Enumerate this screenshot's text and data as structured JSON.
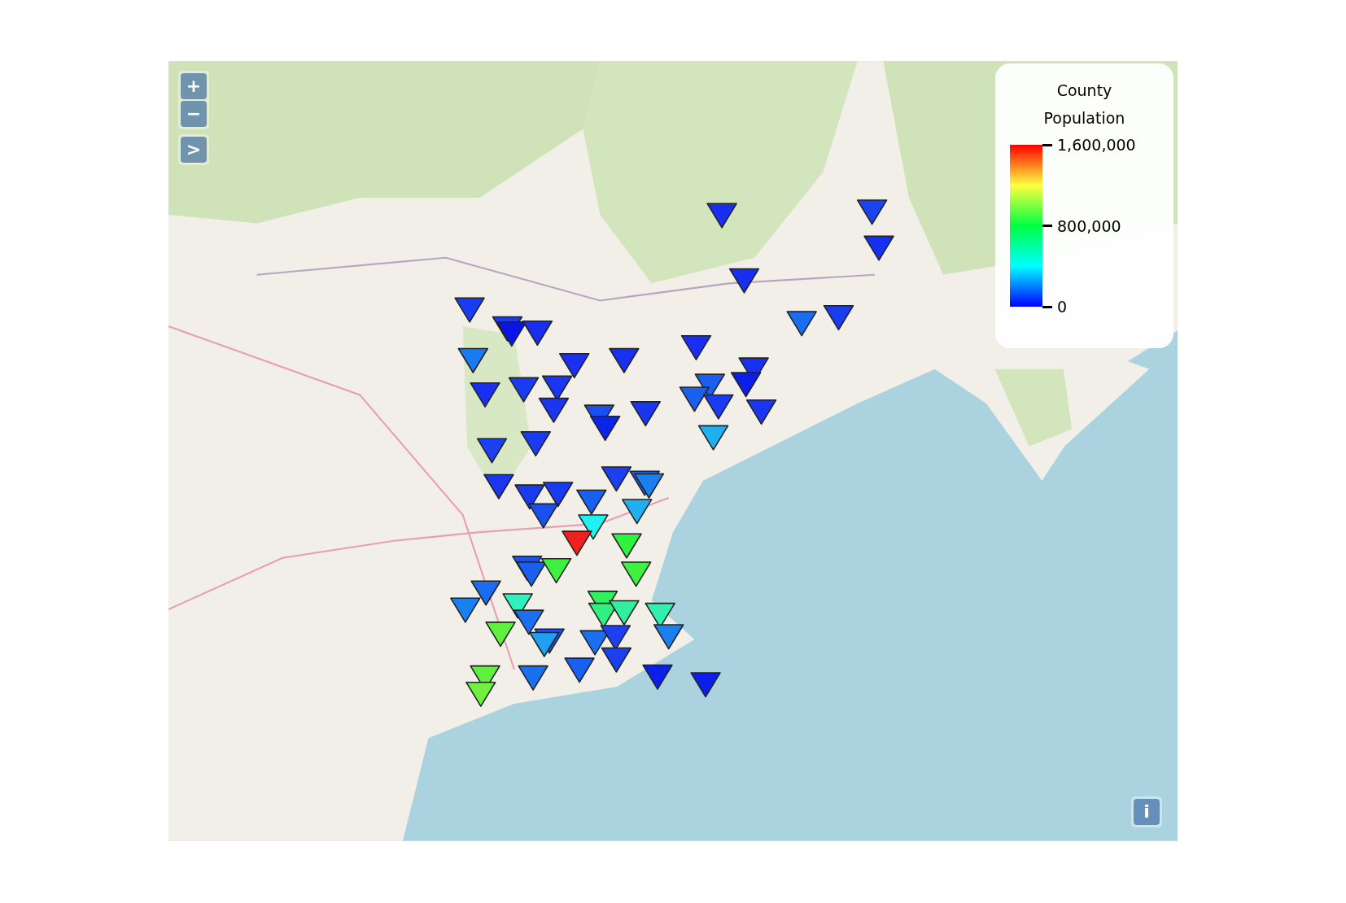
{
  "map_controls": [
    {
      "label": "+",
      "kind": "zoom-in"
    },
    {
      "label": "−",
      "kind": "zoom-out"
    },
    {
      "label": ">",
      "kind": "expand"
    }
  ],
  "info_button": {
    "label": "i"
  },
  "legend": {
    "title": "County Population",
    "ticks": [
      "1,600,000",
      "800,000",
      "0"
    ]
  },
  "markers": [
    {
      "color": "#1a2ef0"
    },
    {
      "color": "#1a44f0"
    },
    {
      "color": "#1530f0"
    },
    {
      "color": "#1a2ef0"
    },
    {
      "color": "#1a3cf0"
    },
    {
      "color": "#1a3cf0"
    },
    {
      "color": "#0a14e8"
    },
    {
      "color": "#1a2ef0"
    },
    {
      "color": "#1a6cf0"
    },
    {
      "color": "#1a3cf0"
    },
    {
      "color": "#1a7af0"
    },
    {
      "color": "#1a30f0"
    },
    {
      "color": "#1a30f0"
    },
    {
      "color": "#1a2ef0"
    },
    {
      "color": "#1a30f0"
    },
    {
      "color": "#1a30f0"
    },
    {
      "color": "#1a3cf0"
    },
    {
      "color": "#1a36f0"
    },
    {
      "color": "#1a60f0"
    },
    {
      "color": "#1a60f0"
    },
    {
      "color": "#1a3cf0"
    },
    {
      "color": "#0a20e8"
    },
    {
      "color": "#1a36f0"
    },
    {
      "color": "#1a50f0"
    },
    {
      "color": "#0a24e8"
    },
    {
      "color": "#1a36f0"
    },
    {
      "color": "#1a36f0"
    },
    {
      "color": "#20b0f0"
    },
    {
      "color": "#1a40f0"
    },
    {
      "color": "#1a3cf0"
    },
    {
      "color": "#1a40f0"
    },
    {
      "color": "#1a60f0"
    },
    {
      "color": "#1a80f0"
    },
    {
      "color": "#1a36f0"
    },
    {
      "color": "#1a3cf0"
    },
    {
      "color": "#1a3cf0"
    },
    {
      "color": "#1a60f0"
    },
    {
      "color": "#1a50f0"
    },
    {
      "color": "#20b0f0"
    },
    {
      "color": "#20f0f0"
    },
    {
      "color": "#f02020"
    },
    {
      "color": "#30f040"
    },
    {
      "color": "#1a50f0"
    },
    {
      "color": "#1a60f0"
    },
    {
      "color": "#40f040"
    },
    {
      "color": "#40f040"
    },
    {
      "color": "#1a6cf0"
    },
    {
      "color": "#1a80f0"
    },
    {
      "color": "#30f0c0"
    },
    {
      "color": "#1a70f0"
    },
    {
      "color": "#30f060"
    },
    {
      "color": "#30f080"
    },
    {
      "color": "#30f0a0"
    },
    {
      "color": "#30f0b0"
    },
    {
      "color": "#60f040"
    },
    {
      "color": "#1a50f0"
    },
    {
      "color": "#20a0f0"
    },
    {
      "color": "#1a70f0"
    },
    {
      "color": "#1a40f0"
    },
    {
      "color": "#1a80f0"
    },
    {
      "color": "#1a40f0"
    },
    {
      "color": "#60f040"
    },
    {
      "color": "#1a70f0"
    },
    {
      "color": "#1a60f0"
    },
    {
      "color": "#0a20e8"
    },
    {
      "color": "#0a20e8"
    },
    {
      "color": "#70f040"
    }
  ]
}
